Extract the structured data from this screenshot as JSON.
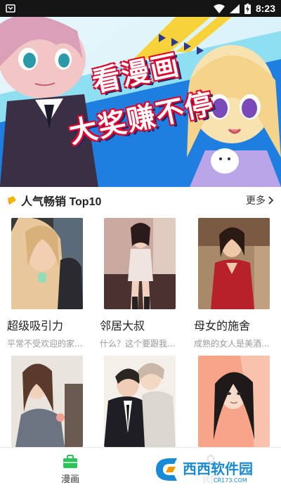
{
  "status_bar": {
    "time": "8:23",
    "icons": [
      "notification-icon",
      "wifi-icon",
      "signal-icon",
      "battery-charging-icon"
    ]
  },
  "banner": {
    "line1": "看漫画",
    "line2": "大奖赚不停"
  },
  "section": {
    "title": "人气畅销 Top10",
    "more_label": "更多",
    "more_icon": "chevron-right-icon",
    "title_icon": "ribbon-icon"
  },
  "comics": [
    {
      "title": "超级吸引力",
      "desc": "平常不受欢迎的家..."
    },
    {
      "title": "邻居大叔",
      "desc": "什么？这个要跟我..."
    },
    {
      "title": "母女的施舍",
      "desc": "成熟的女人是美酒..."
    },
    {
      "title": "",
      "desc": ""
    },
    {
      "title": "",
      "desc": ""
    },
    {
      "title": "",
      "desc": ""
    }
  ],
  "bottom_nav": {
    "items": [
      {
        "label": "漫画",
        "icon": "briefcase-icon",
        "active": true
      },
      {
        "label": "我的",
        "icon": "user-icon",
        "active": false
      }
    ]
  },
  "watermark": {
    "text": "西西软件园",
    "sub": "CR173.COM"
  },
  "colors": {
    "accent": "#2ec25b",
    "banner_blue": "#1f7fe0",
    "banner_red": "#e4002b",
    "text_muted": "#999999"
  }
}
